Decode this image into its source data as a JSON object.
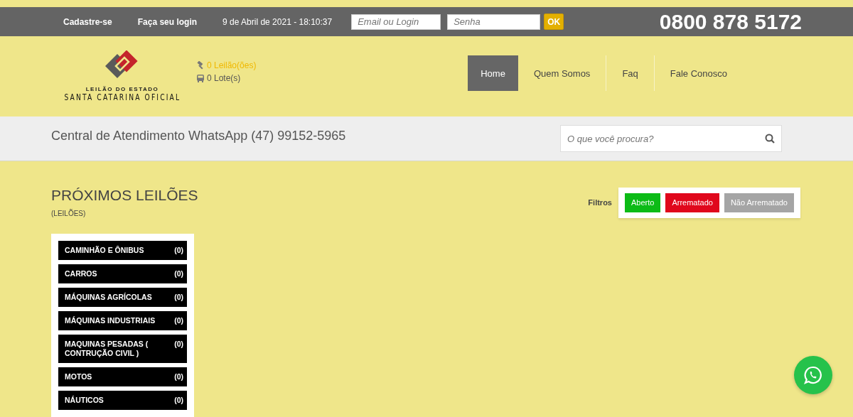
{
  "topbar": {
    "links": [
      "Cadastre-se",
      "Faça seu login"
    ],
    "datetime": "9 de Abril de 2021 - 18:10:37",
    "login_field": {
      "placeholder": "Email ou Login"
    },
    "password_field": {
      "placeholder": "Senha"
    },
    "ok_button": "OK",
    "phone": "0800 878 5172"
  },
  "logo": {
    "small_text": "LEILÃO DO ESTADO",
    "big_text": "SANTA CATARINA OFICIAL"
  },
  "counters": [
    {
      "kind": "gavel",
      "label": "0 Leilão(ões)"
    },
    {
      "kind": "bus",
      "label": "0 Lote(s)"
    }
  ],
  "nav": [
    {
      "label": "Home",
      "selected": true
    },
    {
      "label": "Quem Somos",
      "selected": false
    },
    {
      "label": "Faq",
      "selected": false
    },
    {
      "label": "Fale Conosco",
      "selected": false
    }
  ],
  "contact_bar": {
    "text": "Central de Atendimento WhatsApp (47) 99152-5965",
    "search": {
      "placeholder": "O que você procura?"
    }
  },
  "section": {
    "title": "PRÓXIMOS LEILÕES",
    "subtitle": "(LEILÕES)"
  },
  "filters": {
    "label": "Filtros",
    "buttons": [
      {
        "label": "Aberto",
        "color": "#0cbb16"
      },
      {
        "label": "Arrematado",
        "color": "#e0081c"
      },
      {
        "label": "Não Arrematado",
        "color": "#a5a5a5"
      }
    ]
  },
  "categories": [
    {
      "name": "CAMINHÃO E ÔNIBUS",
      "count": "(0)"
    },
    {
      "name": "CARROS",
      "count": "(0)"
    },
    {
      "name": "MÁQUINAS AGRÍCOLAS",
      "count": "(0)"
    },
    {
      "name": "MÁQUINAS INDUSTRIAIS",
      "count": "(0)"
    },
    {
      "name": "MAQUINAS PESADAS ( CONTRUÇÃO CIVIL )",
      "count": "(0)"
    },
    {
      "name": "MOTOS",
      "count": "(0)"
    },
    {
      "name": "NÁUTICOS",
      "count": "(0)"
    }
  ]
}
